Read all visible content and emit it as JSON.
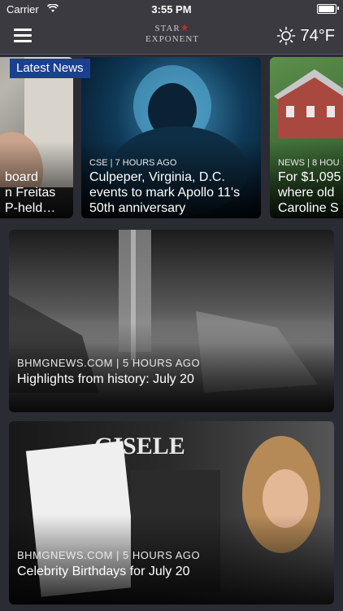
{
  "status_bar": {
    "carrier": "Carrier",
    "time": "3:55 PM"
  },
  "header": {
    "logo_line1": "STAR",
    "logo_line2": "EXPONENT",
    "temperature": "74°F",
    "weather_icon": "sun-icon",
    "menu_icon": "hamburger-icon"
  },
  "latest_news": {
    "label": "Latest News"
  },
  "carousel": [
    {
      "meta": "",
      "title_lines": [
        "board",
        "n Freitas",
        "P-held…"
      ]
    },
    {
      "meta": "CSE | 7 HOURS AGO",
      "title_lines": [
        "Culpeper, Virginia, D.C.",
        "events to mark Apollo 11's",
        "50th anniversary"
      ]
    },
    {
      "meta": "NEWS | 8 HOU",
      "title_lines": [
        "For $1,095",
        "where old",
        "Caroline S"
      ]
    }
  ],
  "feed": [
    {
      "meta": "BHMGNEWS.COM | 5 HOURS AGO",
      "title": "Highlights from history: July 20"
    },
    {
      "meta": "BHMGNEWS.COM | 5 HOURS AGO",
      "title": "Celebrity Birthdays for July 20"
    }
  ],
  "colors": {
    "background": "#2b2b33",
    "nav": "#3a3a40",
    "badge": "#1c3f8f"
  }
}
